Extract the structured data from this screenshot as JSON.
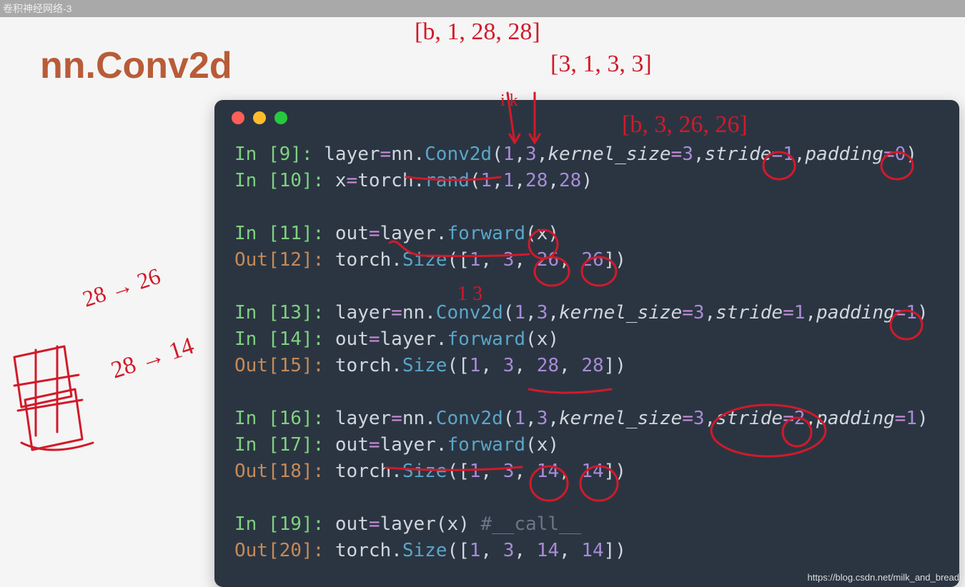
{
  "top_label": "卷积神经网络-3",
  "slide_title": "nn.Conv2d",
  "watermark": "https://blog.csdn.net/milk_and_bread",
  "annotations": {
    "top1": "[b, 1, 28, 28]",
    "top2": "[3, 1, 3, 3]",
    "top3": "[b, 3, 26, 26]",
    "below_1_3": "1  3",
    "left_note1": "28 → 26",
    "left_note2": "28 → 14"
  },
  "code_lines": [
    {
      "kind": "in",
      "n": "9",
      "segments": [
        {
          "t": "layer",
          "c": "ident"
        },
        {
          "t": "=",
          "c": "op"
        },
        {
          "t": "nn",
          "c": "mod"
        },
        {
          "t": ".",
          "c": "ident"
        },
        {
          "t": "Conv2d",
          "c": "func"
        },
        {
          "t": "(",
          "c": "ident"
        },
        {
          "t": "1",
          "c": "num"
        },
        {
          "t": ",",
          "c": "ident"
        },
        {
          "t": "3",
          "c": "num"
        },
        {
          "t": ",",
          "c": "ident"
        },
        {
          "t": "kernel_size",
          "c": "param"
        },
        {
          "t": "=",
          "c": "op"
        },
        {
          "t": "3",
          "c": "num"
        },
        {
          "t": ",",
          "c": "ident"
        },
        {
          "t": "stride",
          "c": "param"
        },
        {
          "t": "=",
          "c": "op"
        },
        {
          "t": "1",
          "c": "num"
        },
        {
          "t": ",",
          "c": "ident"
        },
        {
          "t": "padding",
          "c": "param"
        },
        {
          "t": "=",
          "c": "op"
        },
        {
          "t": "0",
          "c": "num"
        },
        {
          "t": ")",
          "c": "ident"
        }
      ]
    },
    {
      "kind": "in",
      "n": "10",
      "segments": [
        {
          "t": "x",
          "c": "ident"
        },
        {
          "t": "=",
          "c": "op"
        },
        {
          "t": "torch",
          "c": "mod"
        },
        {
          "t": ".",
          "c": "ident"
        },
        {
          "t": "rand",
          "c": "func"
        },
        {
          "t": "(",
          "c": "ident"
        },
        {
          "t": "1",
          "c": "num"
        },
        {
          "t": ",",
          "c": "ident"
        },
        {
          "t": "1",
          "c": "num"
        },
        {
          "t": ",",
          "c": "ident"
        },
        {
          "t": "28",
          "c": "num"
        },
        {
          "t": ",",
          "c": "ident"
        },
        {
          "t": "28",
          "c": "num"
        },
        {
          "t": ")",
          "c": "ident"
        }
      ]
    },
    {
      "kind": "blank"
    },
    {
      "kind": "in",
      "n": "11",
      "segments": [
        {
          "t": "out",
          "c": "ident"
        },
        {
          "t": "=",
          "c": "op"
        },
        {
          "t": "layer",
          "c": "ident"
        },
        {
          "t": ".",
          "c": "ident"
        },
        {
          "t": "forward",
          "c": "func"
        },
        {
          "t": "(",
          "c": "ident"
        },
        {
          "t": "x",
          "c": "ident"
        },
        {
          "t": ")",
          "c": "ident"
        }
      ]
    },
    {
      "kind": "out",
      "n": "12",
      "segments": [
        {
          "t": "torch",
          "c": "mod"
        },
        {
          "t": ".",
          "c": "ident"
        },
        {
          "t": "Size",
          "c": "func"
        },
        {
          "t": "([",
          "c": "ident"
        },
        {
          "t": "1",
          "c": "num"
        },
        {
          "t": ", ",
          "c": "ident"
        },
        {
          "t": "3",
          "c": "num"
        },
        {
          "t": ", ",
          "c": "ident"
        },
        {
          "t": "26",
          "c": "num"
        },
        {
          "t": ", ",
          "c": "ident"
        },
        {
          "t": "26",
          "c": "num"
        },
        {
          "t": "])",
          "c": "ident"
        }
      ]
    },
    {
      "kind": "blank"
    },
    {
      "kind": "in",
      "n": "13",
      "segments": [
        {
          "t": "layer",
          "c": "ident"
        },
        {
          "t": "=",
          "c": "op"
        },
        {
          "t": "nn",
          "c": "mod"
        },
        {
          "t": ".",
          "c": "ident"
        },
        {
          "t": "Conv2d",
          "c": "func"
        },
        {
          "t": "(",
          "c": "ident"
        },
        {
          "t": "1",
          "c": "num"
        },
        {
          "t": ",",
          "c": "ident"
        },
        {
          "t": "3",
          "c": "num"
        },
        {
          "t": ",",
          "c": "ident"
        },
        {
          "t": "kernel_size",
          "c": "param"
        },
        {
          "t": "=",
          "c": "op"
        },
        {
          "t": "3",
          "c": "num"
        },
        {
          "t": ",",
          "c": "ident"
        },
        {
          "t": "stride",
          "c": "param"
        },
        {
          "t": "=",
          "c": "op"
        },
        {
          "t": "1",
          "c": "num"
        },
        {
          "t": ",",
          "c": "ident"
        },
        {
          "t": "padding",
          "c": "param"
        },
        {
          "t": "=",
          "c": "op"
        },
        {
          "t": "1",
          "c": "num"
        },
        {
          "t": ")",
          "c": "ident"
        }
      ]
    },
    {
      "kind": "in",
      "n": "14",
      "segments": [
        {
          "t": "out",
          "c": "ident"
        },
        {
          "t": "=",
          "c": "op"
        },
        {
          "t": "layer",
          "c": "ident"
        },
        {
          "t": ".",
          "c": "ident"
        },
        {
          "t": "forward",
          "c": "func"
        },
        {
          "t": "(",
          "c": "ident"
        },
        {
          "t": "x",
          "c": "ident"
        },
        {
          "t": ")",
          "c": "ident"
        }
      ]
    },
    {
      "kind": "out",
      "n": "15",
      "segments": [
        {
          "t": "torch",
          "c": "mod"
        },
        {
          "t": ".",
          "c": "ident"
        },
        {
          "t": "Size",
          "c": "func"
        },
        {
          "t": "([",
          "c": "ident"
        },
        {
          "t": "1",
          "c": "num"
        },
        {
          "t": ", ",
          "c": "ident"
        },
        {
          "t": "3",
          "c": "num"
        },
        {
          "t": ", ",
          "c": "ident"
        },
        {
          "t": "28",
          "c": "num"
        },
        {
          "t": ", ",
          "c": "ident"
        },
        {
          "t": "28",
          "c": "num"
        },
        {
          "t": "])",
          "c": "ident"
        }
      ]
    },
    {
      "kind": "blank"
    },
    {
      "kind": "in",
      "n": "16",
      "segments": [
        {
          "t": "layer",
          "c": "ident"
        },
        {
          "t": "=",
          "c": "op"
        },
        {
          "t": "nn",
          "c": "mod"
        },
        {
          "t": ".",
          "c": "ident"
        },
        {
          "t": "Conv2d",
          "c": "func"
        },
        {
          "t": "(",
          "c": "ident"
        },
        {
          "t": "1",
          "c": "num"
        },
        {
          "t": ",",
          "c": "ident"
        },
        {
          "t": "3",
          "c": "num"
        },
        {
          "t": ",",
          "c": "ident"
        },
        {
          "t": "kernel_size",
          "c": "param"
        },
        {
          "t": "=",
          "c": "op"
        },
        {
          "t": "3",
          "c": "num"
        },
        {
          "t": ",",
          "c": "ident"
        },
        {
          "t": "stride",
          "c": "param"
        },
        {
          "t": "=",
          "c": "op"
        },
        {
          "t": "2",
          "c": "num"
        },
        {
          "t": ",",
          "c": "ident"
        },
        {
          "t": "padding",
          "c": "param"
        },
        {
          "t": "=",
          "c": "op"
        },
        {
          "t": "1",
          "c": "num"
        },
        {
          "t": ")",
          "c": "ident"
        }
      ]
    },
    {
      "kind": "in",
      "n": "17",
      "segments": [
        {
          "t": "out",
          "c": "ident"
        },
        {
          "t": "=",
          "c": "op"
        },
        {
          "t": "layer",
          "c": "ident"
        },
        {
          "t": ".",
          "c": "ident"
        },
        {
          "t": "forward",
          "c": "func"
        },
        {
          "t": "(",
          "c": "ident"
        },
        {
          "t": "x",
          "c": "ident"
        },
        {
          "t": ")",
          "c": "ident"
        }
      ]
    },
    {
      "kind": "out",
      "n": "18",
      "segments": [
        {
          "t": "torch",
          "c": "mod"
        },
        {
          "t": ".",
          "c": "ident"
        },
        {
          "t": "Size",
          "c": "func"
        },
        {
          "t": "([",
          "c": "ident"
        },
        {
          "t": "1",
          "c": "num"
        },
        {
          "t": ", ",
          "c": "ident"
        },
        {
          "t": "3",
          "c": "num"
        },
        {
          "t": ", ",
          "c": "ident"
        },
        {
          "t": "14",
          "c": "num"
        },
        {
          "t": ", ",
          "c": "ident"
        },
        {
          "t": "14",
          "c": "num"
        },
        {
          "t": "])",
          "c": "ident"
        }
      ]
    },
    {
      "kind": "blank"
    },
    {
      "kind": "in",
      "n": "19",
      "segments": [
        {
          "t": "out",
          "c": "ident"
        },
        {
          "t": "=",
          "c": "op"
        },
        {
          "t": "layer",
          "c": "ident"
        },
        {
          "t": "(",
          "c": "ident"
        },
        {
          "t": "x",
          "c": "ident"
        },
        {
          "t": ") ",
          "c": "ident"
        },
        {
          "t": "#__call__",
          "c": "comment"
        }
      ]
    },
    {
      "kind": "out",
      "n": "20",
      "segments": [
        {
          "t": "torch",
          "c": "mod"
        },
        {
          "t": ".",
          "c": "ident"
        },
        {
          "t": "Size",
          "c": "func"
        },
        {
          "t": "([",
          "c": "ident"
        },
        {
          "t": "1",
          "c": "num"
        },
        {
          "t": ", ",
          "c": "ident"
        },
        {
          "t": "3",
          "c": "num"
        },
        {
          "t": ", ",
          "c": "ident"
        },
        {
          "t": "14",
          "c": "num"
        },
        {
          "t": ", ",
          "c": "ident"
        },
        {
          "t": "14",
          "c": "num"
        },
        {
          "t": "])",
          "c": "ident"
        }
      ]
    }
  ]
}
